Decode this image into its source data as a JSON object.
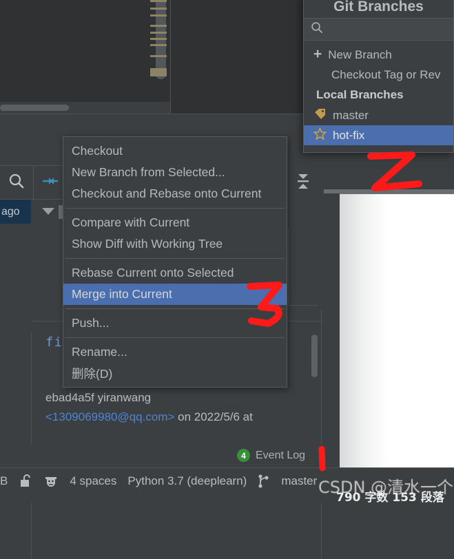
{
  "app": {
    "theme_bg": "#3c3f41",
    "accent_selection": "#4b6eaf",
    "annotation_color": "#ff1a1a"
  },
  "editor": {
    "pane_label": "editor-area",
    "scroll_markers": 9
  },
  "vcs_log": {
    "search_icon": "search-icon",
    "collapse_icon": "collapse-selection-icon",
    "collapse_all_icon": "collapse-all-icon",
    "selected_commit_time": "ago",
    "code_fragment": "fi",
    "commit_author": "ebad4a5f yiranwang",
    "commit_email": "<1309069980@qq.com>",
    "commit_date_suffix": " on 2022/5/6 at"
  },
  "context_menu": {
    "items": [
      {
        "label": "Checkout",
        "selected": false,
        "separator_after": false
      },
      {
        "label": "New Branch from Selected...",
        "selected": false,
        "separator_after": false
      },
      {
        "label": "Checkout and Rebase onto Current",
        "selected": false,
        "separator_after": true
      },
      {
        "label": "Compare with Current",
        "selected": false,
        "separator_after": false
      },
      {
        "label": "Show Diff with Working Tree",
        "selected": false,
        "separator_after": true
      },
      {
        "label": "Rebase Current onto Selected",
        "selected": false,
        "separator_after": false
      },
      {
        "label": "Merge into Current",
        "selected": true,
        "separator_after": true
      },
      {
        "label": "Push...",
        "selected": false,
        "separator_after": true
      },
      {
        "label": "Rename...",
        "selected": false,
        "separator_after": false
      },
      {
        "label": "删除(D)",
        "selected": false,
        "separator_after": false
      }
    ]
  },
  "git_branches": {
    "title": "Git Branches",
    "search_placeholder": "",
    "search_value": "",
    "search_icon": "search-icon",
    "rows": [
      {
        "label": "New Branch",
        "icon": "plus-icon",
        "type": "action",
        "selected": false
      },
      {
        "label": "Checkout Tag or Rev",
        "icon": "",
        "type": "action-indent",
        "selected": false
      },
      {
        "label": "Local Branches",
        "icon": "",
        "type": "header",
        "selected": false
      },
      {
        "label": "master",
        "icon": "tag-icon",
        "type": "branch",
        "selected": false
      },
      {
        "label": "hot-fix",
        "icon": "star-icon",
        "type": "branch",
        "selected": true
      }
    ]
  },
  "status_bar": {
    "event_log_label": "Event Log",
    "event_log_badge": "4",
    "column_indicator": "B",
    "lock_icon": "lock-open-icon",
    "hacker_icon": "hacker-icon",
    "indent_label": "4 spaces",
    "interpreter_label": "Python 3.7 (deeplearn)",
    "branch_icon": "git-branch-icon",
    "branch_label": "master"
  },
  "annotations": {
    "marker_1": "1",
    "marker_2": "2",
    "marker_3": "3"
  },
  "watermark": {
    "text": "CSDN @清水一个懒",
    "stats": "790 字数   153 段落"
  }
}
